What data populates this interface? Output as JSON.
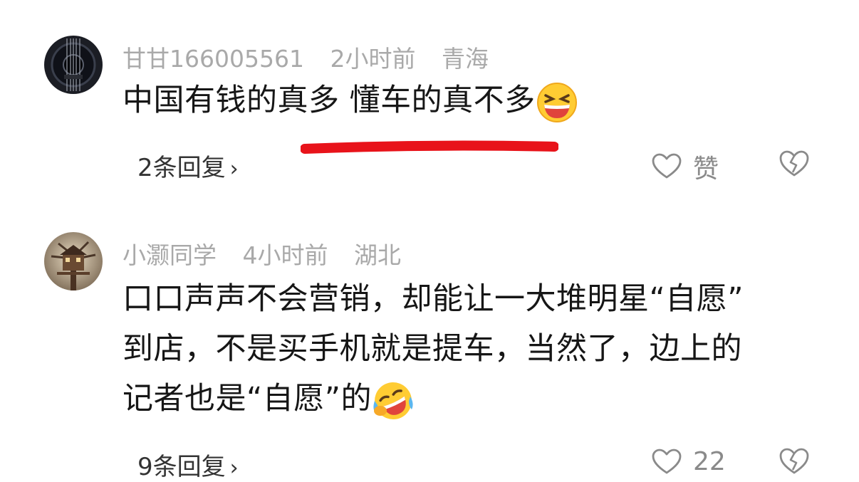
{
  "comments": [
    {
      "username": "甘甘166005561",
      "time": "2小时前",
      "location": "青海",
      "text": "中国有钱的真多 懂车的真不多",
      "emoji": "grinning-squinting-face",
      "replies": "2条回复",
      "like_label": "赞"
    },
    {
      "username": "小灏同学",
      "time": "4小时前",
      "location": "湖北",
      "text_lines": [
        "口口声声不会营销，却能让一大堆明星“自愿”",
        "到店，不是买手机就是提车，当然了，边上的",
        "记者也是“自愿”的"
      ],
      "emoji": "rolling-laughing-face",
      "replies": "9条回复",
      "like_label": "22"
    }
  ],
  "colors": {
    "meta": "#a9a9a9",
    "text": "#161616",
    "annotation": "#e8131a",
    "icon": "#8a8a8a"
  }
}
